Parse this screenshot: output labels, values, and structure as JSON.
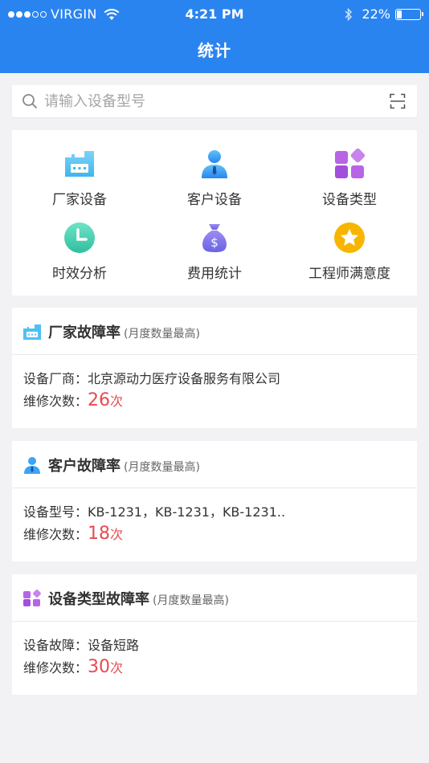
{
  "status_bar": {
    "carrier": "VIRGIN",
    "time": "4:21 PM",
    "battery": "22%",
    "battery_level": 0.22,
    "signal_bars": 3,
    "signal_total": 5
  },
  "nav": {
    "title": "统计"
  },
  "search": {
    "placeholder": "请输入设备型号"
  },
  "menu": [
    {
      "label": "厂家设备",
      "icon": "factory-device-icon"
    },
    {
      "label": "客户设备",
      "icon": "customer-device-icon"
    },
    {
      "label": "设备类型",
      "icon": "device-type-icon"
    },
    {
      "label": "时效分析",
      "icon": "clock-icon"
    },
    {
      "label": "费用统计",
      "icon": "money-bag-icon"
    },
    {
      "label": "工程师满意度",
      "icon": "star-icon"
    }
  ],
  "cards": [
    {
      "title": "厂家故障率",
      "subtitle": "(月度数量最高)",
      "field_label": "设备厂商：",
      "field_value": "北京源动力医疗设备服务有限公司",
      "count_label": "维修次数：",
      "count": "26",
      "count_unit": "次"
    },
    {
      "title": "客户故障率",
      "subtitle": "(月度数量最高)",
      "field_label": "设备型号：",
      "field_value": "KB-1231，KB-1231，KB-1231..",
      "count_label": "维修次数：",
      "count": "18",
      "count_unit": "次"
    },
    {
      "title": "设备类型故障率",
      "subtitle": "(月度数量最高)",
      "field_label": "设备故障：",
      "field_value": "设备短路",
      "count_label": "维修次数：",
      "count": "30",
      "count_unit": "次"
    }
  ],
  "colors": {
    "primary": "#2a84f0",
    "accent_red": "#e84a4f",
    "background": "#f2f2f4"
  }
}
